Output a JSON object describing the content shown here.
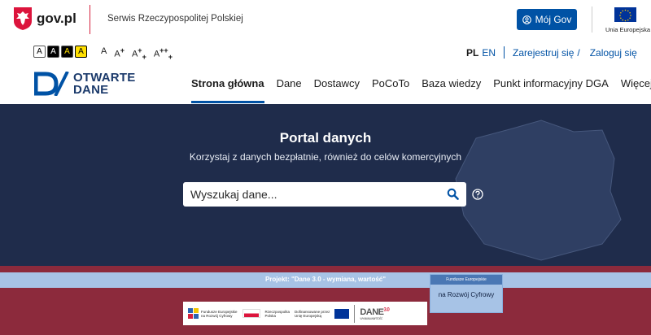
{
  "gov": {
    "logo_text": "gov.pl",
    "serwis": "Serwis Rzeczypospolitej Polskiej",
    "moj_gov": "Mój Gov",
    "ue_label": "Unia Europejska"
  },
  "accessibility": {
    "contrast": [
      "A",
      "A",
      "A",
      "A"
    ],
    "fontsizes": [
      {
        "base": "A",
        "sup": "",
        "sub": ""
      },
      {
        "base": "A",
        "sup": "+",
        "sub": ""
      },
      {
        "base": "A",
        "sup": "+",
        "sub": "+"
      },
      {
        "base": "A",
        "sup": "++",
        "sub": "+"
      }
    ]
  },
  "lang": {
    "pl": "PL",
    "en": "EN"
  },
  "auth": {
    "register": "Zarejestruj się",
    "slash": "/",
    "login": "Zaloguj się"
  },
  "brand": {
    "line1": "OTWARTE",
    "line2": "DANE"
  },
  "nav": {
    "items": [
      "Strona główna",
      "Dane",
      "Dostawcy",
      "PoCoTo",
      "Baza wiedzy",
      "Punkt informacyjny DGA"
    ],
    "more": "Więcej"
  },
  "hero": {
    "title": "Portal danych",
    "subtitle": "Korzystaj z danych bezpłatnie, również do celów komercyjnych",
    "search_placeholder": "Wyszukaj dane..."
  },
  "banner": {
    "project": "Projekt: \"Dane 3.0 - wymiana, wartość\"",
    "card_top": "Fundusze Europejskie",
    "card_text": "na Rozwój Cyfrowy",
    "fe_line1": "Fundusze Europejskie",
    "fe_line2": "na Rozwój Cyfrowy",
    "rp_line1": "Rzeczpospolita",
    "rp_line2": "Polska",
    "ue_line1": "Dofinansowane przez",
    "ue_line2": "Unię Europejską",
    "dane_logo": "DANE",
    "dane_sup": "3.0",
    "dane_sub": "WYMIANA WARTOŚĆ"
  },
  "colors": {
    "primary": "#0052a5",
    "hero_bg": "#1f2c4b",
    "banner_bg": "#8c2a3c",
    "gov_red": "#d4213d"
  }
}
